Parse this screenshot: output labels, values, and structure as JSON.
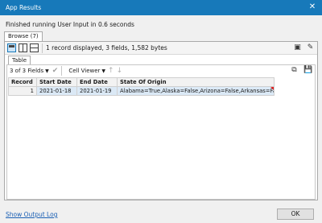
{
  "window": {
    "title": "App Results",
    "close_glyph": "✕"
  },
  "status_text": "Finished running User Input in 0.6 seconds",
  "outer_tabs": [
    {
      "label": "Browse (7)"
    }
  ],
  "toolbar": {
    "record_info": "1 record displayed, 3 fields, 1,582 bytes",
    "layout_icons": [
      "layout-single-icon",
      "layout-vertical-split-icon",
      "layout-horizontal-split-icon"
    ],
    "right_icons": [
      "view-options-icon",
      "pin-icon"
    ]
  },
  "inner_tabs": [
    {
      "label": "Table"
    }
  ],
  "grid_toolbar": {
    "fields_label": "3 of 3 Fields",
    "cell_viewer_label": "Cell Viewer"
  },
  "table": {
    "headers": [
      "Record",
      "Start Date",
      "End Date",
      "State Of Origin"
    ],
    "rows": [
      {
        "record": "1",
        "start_date": "2021-01-18",
        "end_date": "2021-01-19",
        "state_of_origin": "Alabama=True,Alaska=False,Arizona=False,Arkansas=False,C..."
      }
    ]
  },
  "footer": {
    "log_link": "Show Output Log",
    "ok_label": "OK"
  },
  "colors": {
    "titlebar": "#1779ba",
    "truncation_marker": "#e02020",
    "selected_row": "#dbe9f6"
  }
}
